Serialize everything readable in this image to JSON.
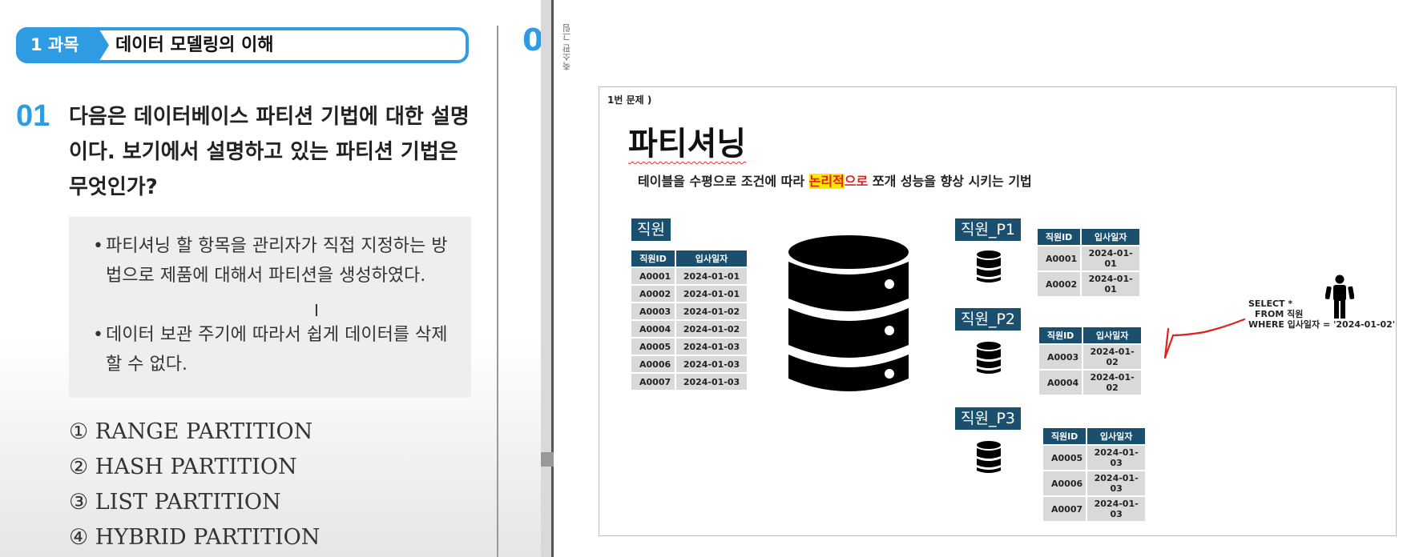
{
  "book": {
    "banner_tag": "1 과목",
    "banner_title": "데이터 모델링의 이해",
    "question_number": "01",
    "question_text": "다음은 데이터베이스 파티션 기법에 대한 설명이다. 보기에서 설명하고 있는 파티션 기법은 무엇인가?",
    "bullets": [
      "파티셔닝 할 항목을 관리자가 직접 지정하는 방법으로 제품에 대해서 파티션을 생성하였다.",
      "데이터 보관 주기에 따라서 쉽게 데이터를 삭제할 수 없다."
    ],
    "options": [
      "① RANGE PARTITION",
      "② HASH PARTITION",
      "③ LIST PARTITION",
      "④ HYBRID PARTITION"
    ],
    "next_page_partial": "0",
    "cursor_glyph": "I"
  },
  "side_label": "축소판 그림",
  "slide": {
    "problem_label": "1번 문제 )",
    "title": "파티셔닝",
    "desc_before": "테이블을 수평으로 조건에 따라 ",
    "desc_highlight": "논리적",
    "desc_red": "으로",
    "desc_after": " 쪼개 성능을 향상 시키는 기법",
    "main_table": {
      "name": "직원",
      "headers": [
        "직원ID",
        "입사일자"
      ],
      "rows": [
        [
          "A0001",
          "2024-01-01"
        ],
        [
          "A0002",
          "2024-01-01"
        ],
        [
          "A0003",
          "2024-01-02"
        ],
        [
          "A0004",
          "2024-01-02"
        ],
        [
          "A0005",
          "2024-01-03"
        ],
        [
          "A0006",
          "2024-01-03"
        ],
        [
          "A0007",
          "2024-01-03"
        ]
      ]
    },
    "partitions": [
      {
        "name": "직원_P1",
        "headers": [
          "직원ID",
          "입사일자"
        ],
        "rows": [
          [
            "A0001",
            "2024-01-01"
          ],
          [
            "A0002",
            "2024-01-01"
          ]
        ]
      },
      {
        "name": "직원_P2",
        "headers": [
          "직원ID",
          "입사일자"
        ],
        "rows": [
          [
            "A0003",
            "2024-01-02"
          ],
          [
            "A0004",
            "2024-01-02"
          ]
        ]
      },
      {
        "name": "직원_P3",
        "headers": [
          "직원ID",
          "입사일자"
        ],
        "rows": [
          [
            "A0005",
            "2024-01-03"
          ],
          [
            "A0006",
            "2024-01-03"
          ],
          [
            "A0007",
            "2024-01-03"
          ]
        ]
      }
    ],
    "sql": [
      "SELECT *",
      "FROM 직원",
      "WHERE 입사일자 = '2024-01-02'"
    ]
  }
}
